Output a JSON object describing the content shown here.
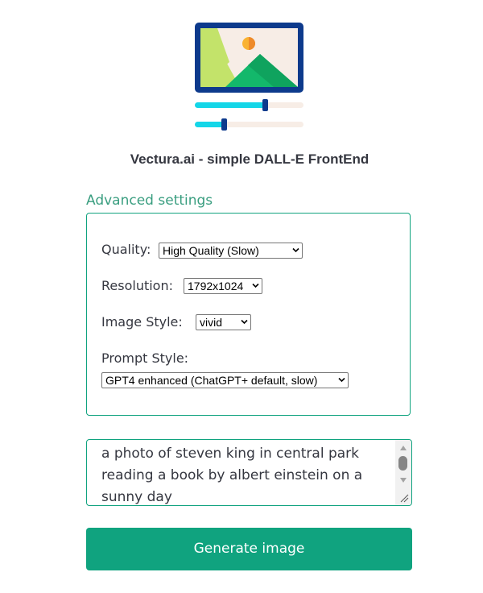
{
  "app": {
    "title": "Vectura.ai - simple DALL-E FrontEnd",
    "logo_icon": "image-sliders-icon"
  },
  "advanced": {
    "label": "Advanced settings",
    "quality": {
      "label": "Quality:",
      "value": "High Quality (Slow)"
    },
    "resolution": {
      "label": "Resolution:",
      "value": "1792x1024"
    },
    "image_style": {
      "label": "Image Style:",
      "value": "vivid"
    },
    "prompt_style": {
      "label": "Prompt Style:",
      "value": "GPT4 enhanced (ChatGPT+ default, slow)"
    }
  },
  "prompt": {
    "value": "a photo of steven king in central park reading a book by albert einstein on a sunny day"
  },
  "generate_button": {
    "label": "Generate image"
  },
  "colors": {
    "accent": "#10a37f",
    "accent_text": "#3a9e80",
    "text": "#353740"
  }
}
